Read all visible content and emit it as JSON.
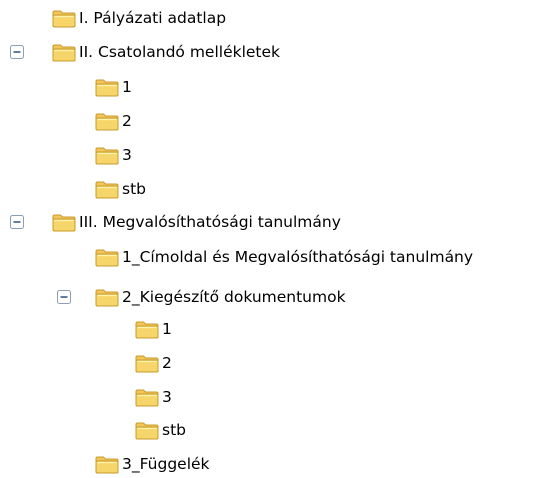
{
  "tree": {
    "nodes": [
      {
        "id": "n1",
        "label": "I. Pályázati adatlap",
        "depth": 0,
        "expandable": false
      },
      {
        "id": "n2",
        "label": "II. Csatolandó mellékletek",
        "depth": 0,
        "expandable": true,
        "expanded": true
      },
      {
        "id": "n3",
        "label": "1",
        "depth": 1,
        "expandable": false
      },
      {
        "id": "n4",
        "label": "2",
        "depth": 1,
        "expandable": false
      },
      {
        "id": "n5",
        "label": "3",
        "depth": 1,
        "expandable": false
      },
      {
        "id": "n6",
        "label": "stb",
        "depth": 1,
        "expandable": false
      },
      {
        "id": "n7",
        "label": "III. Megvalósíthatósági tanulmány",
        "depth": 0,
        "expandable": true,
        "expanded": true
      },
      {
        "id": "n8",
        "label": "1_Címoldal és Megvalósíthatósági tanulmány",
        "depth": 1,
        "expandable": false
      },
      {
        "id": "n9",
        "label": "2_Kiegészítő dokumentumok",
        "depth": 1,
        "expandable": true,
        "expanded": true
      },
      {
        "id": "n10",
        "label": "1",
        "depth": 2,
        "expandable": false
      },
      {
        "id": "n11",
        "label": "2",
        "depth": 2,
        "expandable": false
      },
      {
        "id": "n12",
        "label": "3",
        "depth": 2,
        "expandable": false
      },
      {
        "id": "n13",
        "label": "stb",
        "depth": 2,
        "expandable": false
      },
      {
        "id": "n14",
        "label": "3_Függelék",
        "depth": 1,
        "expandable": false
      }
    ],
    "icons": {
      "folder": "folder-icon",
      "toggle": "collapse-minus-icon"
    },
    "colors": {
      "folder_body": "#f6d66a",
      "folder_tab": "#f3c65a",
      "folder_stroke": "#c89b2e",
      "folder_highlight": "#fff3b0",
      "toggle_border": "#8c9fb8",
      "toggle_fill": "#ffffff",
      "toggle_minus": "#3a5f8a"
    }
  }
}
